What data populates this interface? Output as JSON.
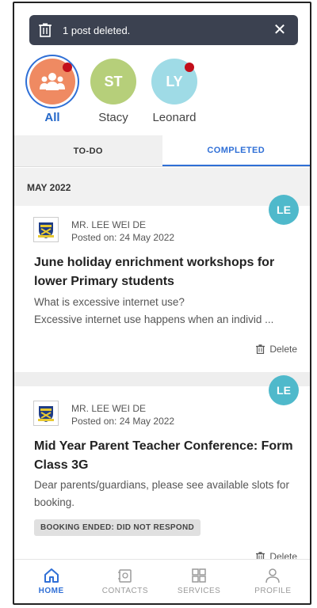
{
  "toast": {
    "message": "1 post deleted.",
    "close_icon": "close-icon"
  },
  "children": [
    {
      "initials": "",
      "label": "All",
      "color": "#ef8a62",
      "unread": true,
      "active": true
    },
    {
      "initials": "ST",
      "label": "Stacy",
      "color": "#b6cf7a",
      "unread": false,
      "active": false
    },
    {
      "initials": "LY",
      "label": "Leonard",
      "color": "#9fdbe6",
      "unread": true,
      "active": false
    }
  ],
  "tabs": [
    {
      "label": "TO-DO",
      "active": false
    },
    {
      "label": "COMPLETED",
      "active": true
    }
  ],
  "section": {
    "month": "MAY 2022"
  },
  "posts": [
    {
      "badge": "LE",
      "sender": "MR. LEE WEI DE",
      "posted_on": "Posted on: 24 May 2022",
      "title": "June holiday enrichment workshops for lower Primary students",
      "preview_line1": "What is excessive internet use?",
      "preview_line2": "Excessive internet use happens when an individ ...",
      "status": "",
      "delete_label": "Delete"
    },
    {
      "badge": "LE",
      "sender": "MR. LEE WEI DE",
      "posted_on": "Posted on: 24 May 2022",
      "title": "Mid Year Parent Teacher Conference: Form Class 3G",
      "preview_line1": "Dear parents/guardians, please see available slots for booking.",
      "preview_line2": "",
      "status": "BOOKING ENDED: DID NOT RESPOND",
      "delete_label": "Delete"
    }
  ],
  "nav": [
    {
      "label": "HOME",
      "icon": "home-icon",
      "active": true
    },
    {
      "label": "CONTACTS",
      "icon": "contacts-icon",
      "active": false
    },
    {
      "label": "SERVICES",
      "icon": "services-icon",
      "active": false
    },
    {
      "label": "PROFILE",
      "icon": "profile-icon",
      "active": false
    }
  ],
  "colors": {
    "accent": "#2f6fd6",
    "toast_bg": "#3b4150",
    "badge_le": "#4fb9cb",
    "unread_dot": "#c20e1a"
  }
}
